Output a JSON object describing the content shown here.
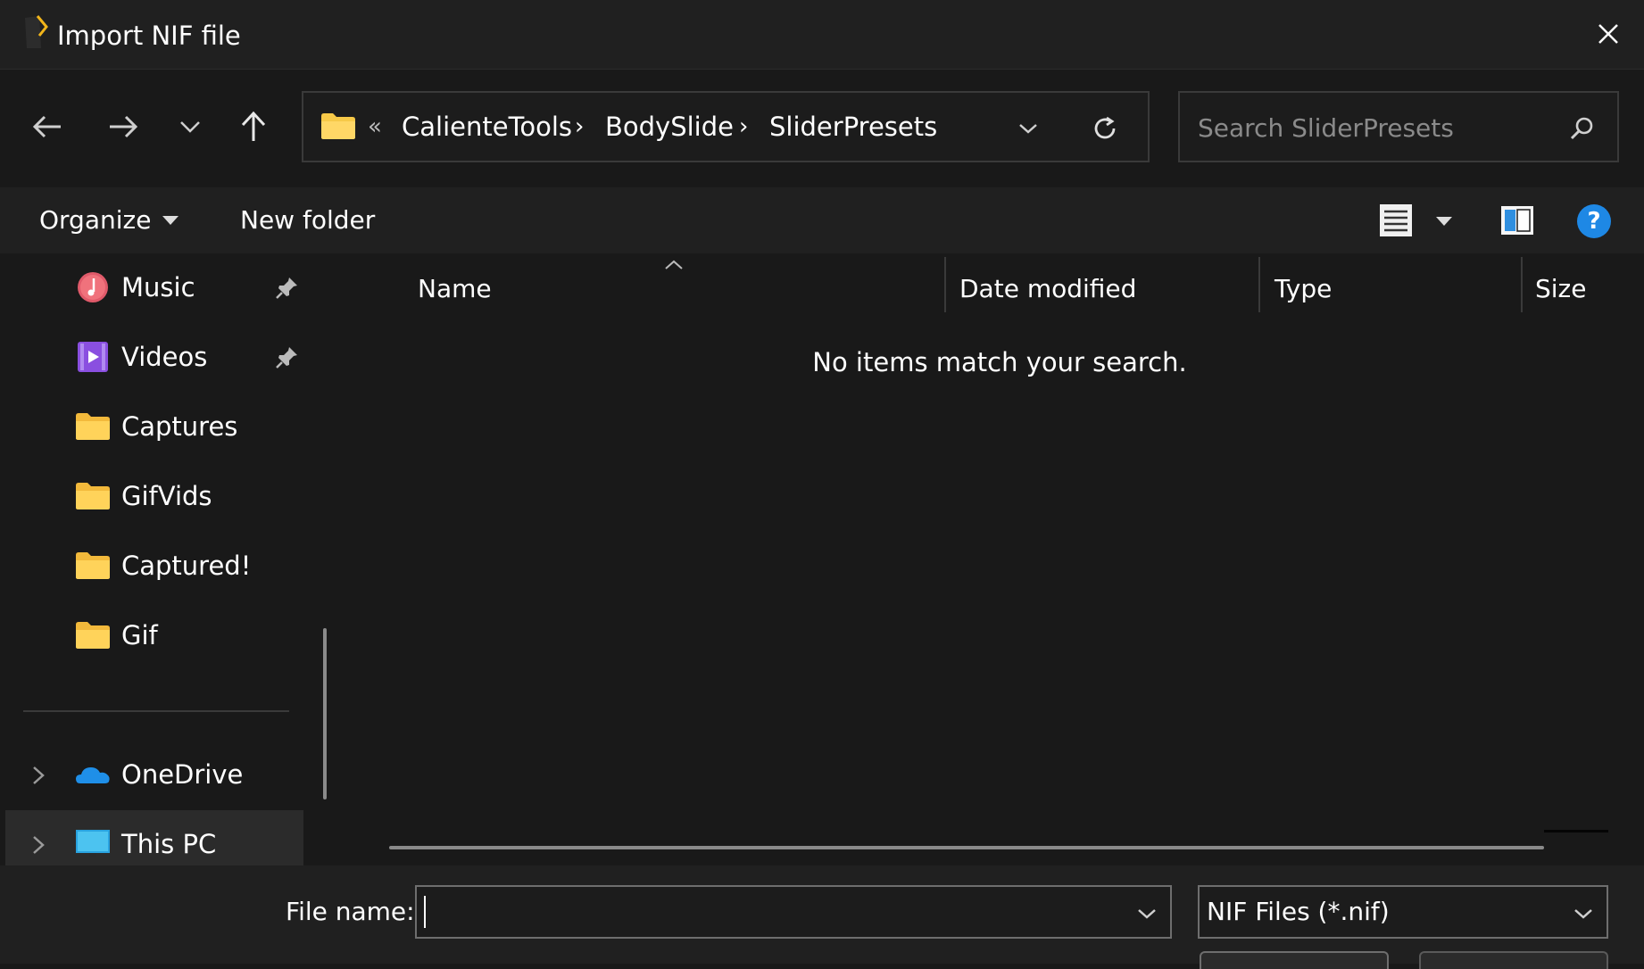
{
  "window": {
    "title": "Import NIF file"
  },
  "nav": {
    "breadcrumbs": [
      "CalienteTools",
      "BodySlide",
      "SliderPresets"
    ],
    "overflow_glyph": "«",
    "separator_glyph": "›"
  },
  "search": {
    "placeholder": "Search SliderPresets"
  },
  "toolbar": {
    "organize_label": "Organize",
    "new_folder_label": "New folder",
    "help_glyph": "?"
  },
  "sidebar": {
    "items": [
      {
        "label": "Music",
        "icon": "music-icon",
        "pinned": true
      },
      {
        "label": "Videos",
        "icon": "videos-icon",
        "pinned": true
      },
      {
        "label": "Captures",
        "icon": "folder-icon"
      },
      {
        "label": "GifVids",
        "icon": "folder-icon"
      },
      {
        "label": "Captured!",
        "icon": "folder-icon"
      },
      {
        "label": "Gif",
        "icon": "folder-icon"
      }
    ],
    "locations": [
      {
        "label": "OneDrive",
        "icon": "onedrive-icon"
      },
      {
        "label": "This PC",
        "icon": "this-pc-icon"
      }
    ]
  },
  "list": {
    "columns": [
      "Name",
      "Date modified",
      "Type",
      "Size"
    ],
    "empty_message": "No items match your search."
  },
  "footer": {
    "file_name_label": "File name:",
    "file_name_value": "",
    "file_type_selected": "NIF Files (*.nif)"
  },
  "colors": {
    "background": "#191919",
    "toolbar": "#202020",
    "folder": "#f7c948",
    "accent": "#0078d4",
    "text": "#ffffff"
  }
}
